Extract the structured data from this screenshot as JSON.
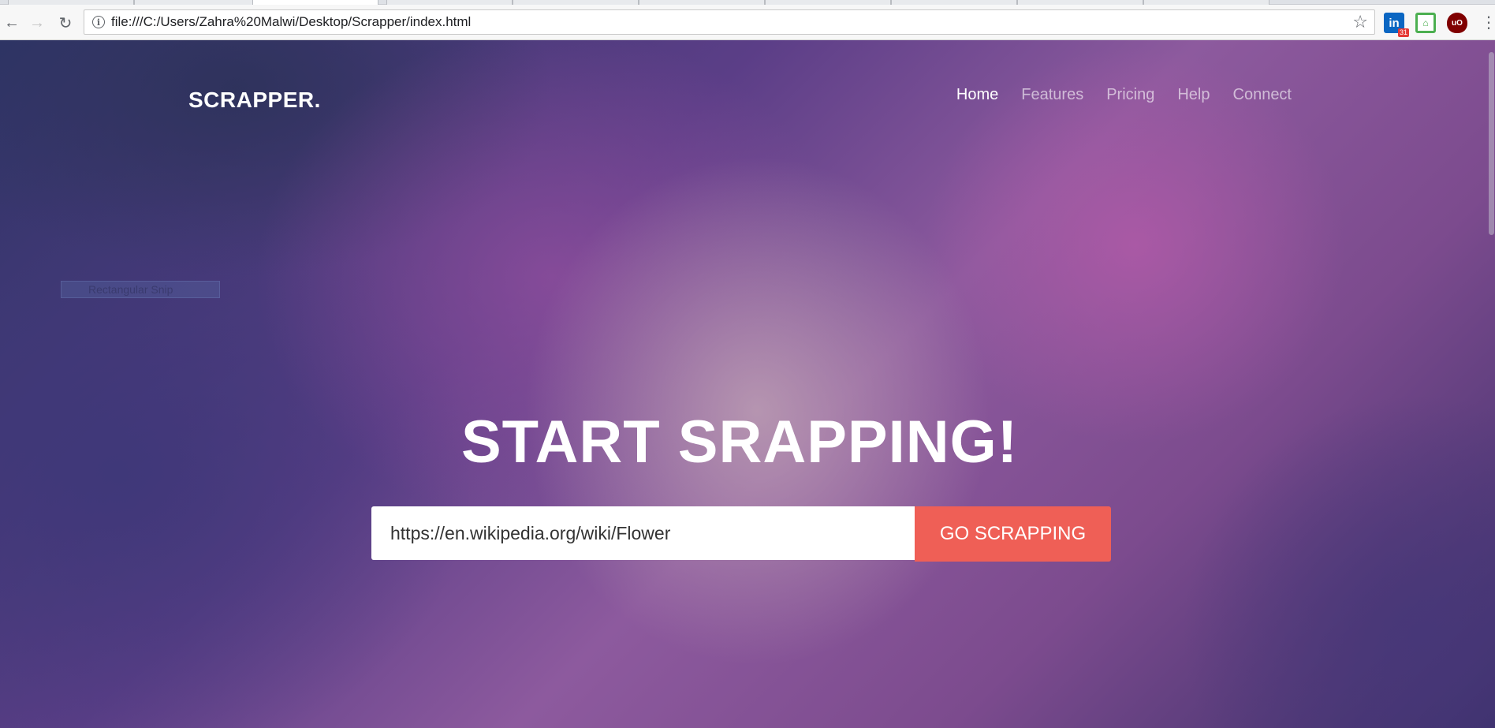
{
  "browser": {
    "url": "file:///C:/Users/Zahra%20Malwi/Desktop/Scrapper/index.html",
    "extensions": {
      "linkedin_label": "in",
      "linkedin_badge": "31",
      "green_label": "⌂",
      "ublock_label": "uO"
    }
  },
  "site": {
    "brand": "SCRAPPER.",
    "nav": [
      {
        "label": "Home",
        "active": true
      },
      {
        "label": "Features"
      },
      {
        "label": "Pricing"
      },
      {
        "label": "Help"
      },
      {
        "label": "Connect"
      }
    ],
    "ghost_overlay_label": "Rectangular Snip"
  },
  "hero": {
    "title": "START SRAPPING!",
    "search_value": "https://en.wikipedia.org/wiki/Flower",
    "button_label": "GO SCRAPPING"
  },
  "colors": {
    "button": "#ef5f56",
    "nav_active": "#ffffff"
  }
}
